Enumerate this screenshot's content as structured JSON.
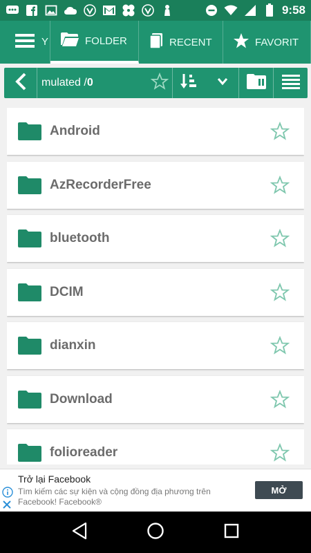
{
  "status_bar": {
    "time": "9:58",
    "left_icons": [
      "messages-icon",
      "facebook-icon",
      "image-icon",
      "cloud-icon",
      "vpn-icon",
      "gmail-icon",
      "pinwheel-icon",
      "vpn-icon",
      "figure-icon"
    ],
    "right_icons": [
      "do-not-disturb-icon",
      "wifi-icon",
      "signal-icon",
      "battery-icon"
    ]
  },
  "tabs": {
    "partial_label": "Y",
    "folder": "FOLDER",
    "recent": "RECENT",
    "favorites": "FAVORIT"
  },
  "path_bar": {
    "path_text": "mulated / ",
    "path_count": "0"
  },
  "folders": [
    {
      "name": "Android"
    },
    {
      "name": "AzRecorderFree"
    },
    {
      "name": "bluetooth"
    },
    {
      "name": "DCIM"
    },
    {
      "name": "dianxin"
    },
    {
      "name": "Download"
    },
    {
      "name": "folioreader"
    }
  ],
  "ad": {
    "title": "Trở lại Facebook",
    "description": "Tìm kiếm các sự kiện và cộng đồng địa phương trên Facebook! Facebook®",
    "button": "MỞ"
  },
  "colors": {
    "primary": "#1f9470",
    "status_bar": "#1a7f5a",
    "folder_icon": "#1f8a68",
    "star_outline": "#7fc7ae"
  }
}
